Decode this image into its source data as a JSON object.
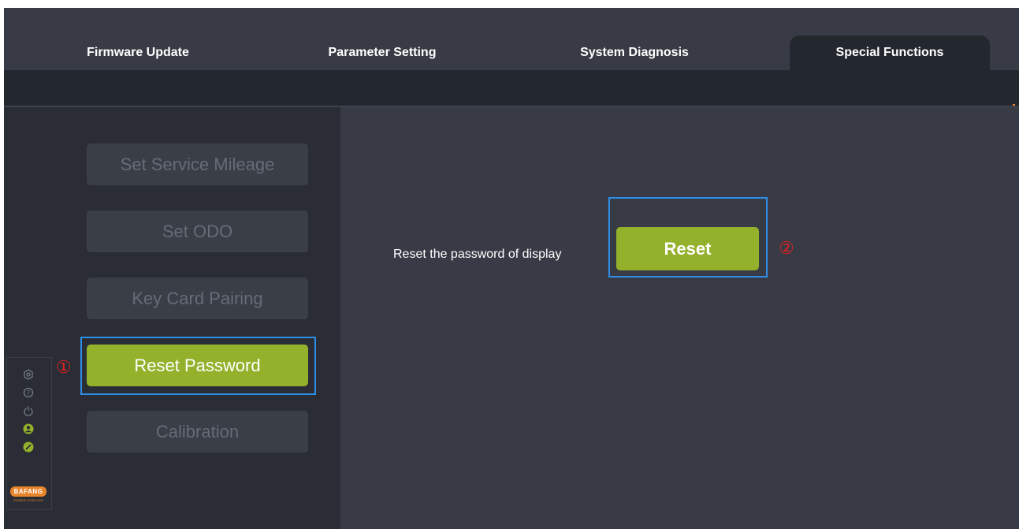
{
  "tabs": [
    {
      "label": "Firmware Update",
      "active": false
    },
    {
      "label": "Parameter Setting",
      "active": false
    },
    {
      "label": "System Diagnosis",
      "active": false
    },
    {
      "label": "Special Functions",
      "active": true
    }
  ],
  "menu": {
    "items": [
      {
        "label": "Set Service Mileage",
        "active": false
      },
      {
        "label": "Set ODO",
        "active": false
      },
      {
        "label": "Key Card Pairing",
        "active": false
      },
      {
        "label": "Reset Password",
        "active": true
      },
      {
        "label": "Calibration",
        "active": false
      }
    ]
  },
  "annotations": {
    "step1": "①",
    "step2": "②"
  },
  "main": {
    "description": "Reset the password of display",
    "reset_label": "Reset"
  },
  "brand": {
    "name": "BAFANG",
    "tagline": "POWER YOUR LIFE"
  },
  "side_icons": [
    "settings-icon",
    "help-icon",
    "power-icon",
    "user-icon",
    "link-icon"
  ],
  "colors": {
    "accent": "#94b12c",
    "highlight": "#2f8fe8",
    "annotation": "#e12222",
    "brand": "#e8842a",
    "panel": "#2a2d35",
    "background": "#383b45"
  }
}
